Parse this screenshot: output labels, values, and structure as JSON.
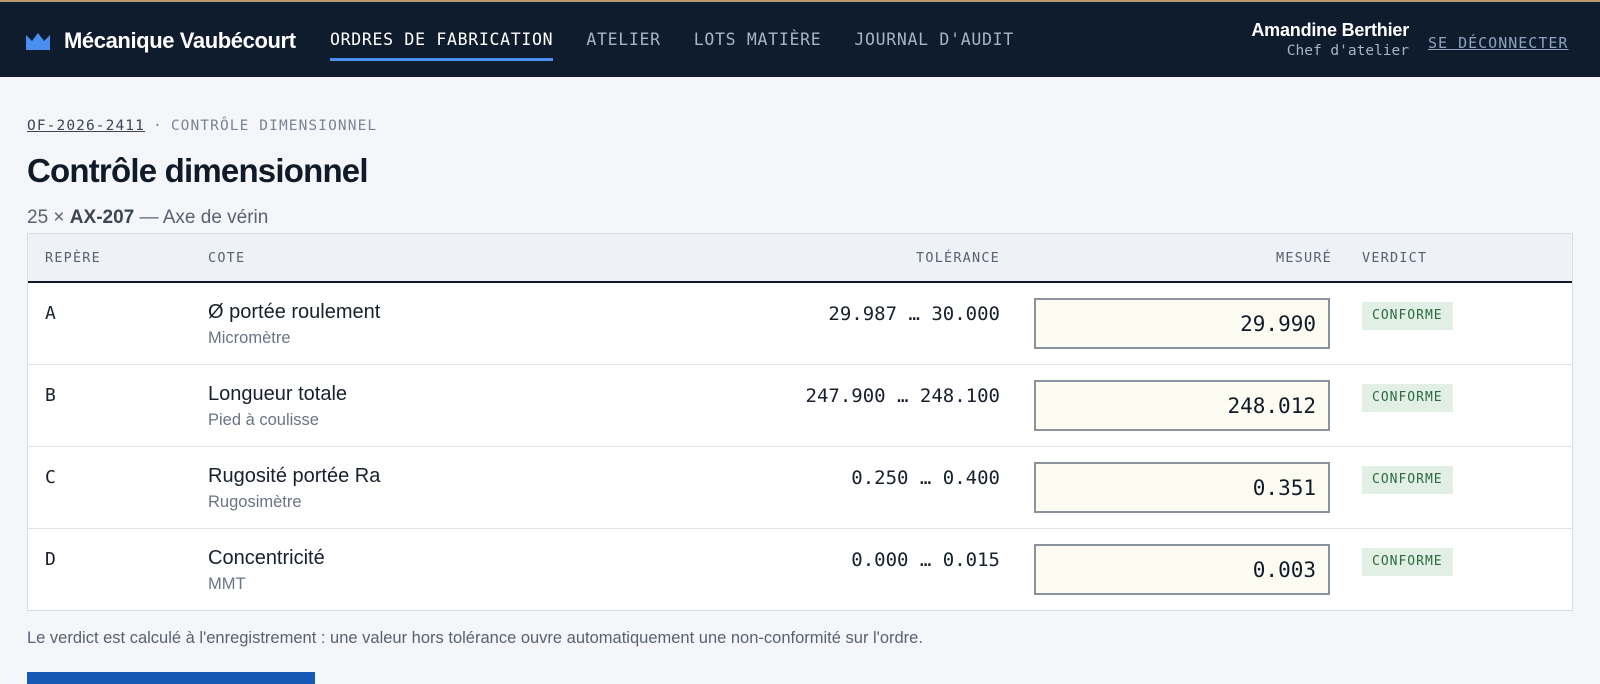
{
  "header": {
    "brand": "Mécanique Vaubécourt",
    "nav": [
      {
        "label": "ORDRES DE FABRICATION",
        "active": true
      },
      {
        "label": "ATELIER",
        "active": false
      },
      {
        "label": "LOTS MATIÈRE",
        "active": false
      },
      {
        "label": "JOURNAL D'AUDIT",
        "active": false
      }
    ],
    "user_name": "Amandine Berthier",
    "user_role": "Chef d'atelier",
    "logout": "SE DÉCONNECTER"
  },
  "breadcrumb": {
    "order_ref": "OF-2026-2411",
    "separator": "·",
    "current": "CONTRÔLE DIMENSIONNEL"
  },
  "page": {
    "title": "Contrôle dimensionnel",
    "qty": "25 ×",
    "part_no": "AX-207",
    "part_desc": "— Axe de vérin"
  },
  "table": {
    "headers": {
      "ref": "REPÈRE",
      "cote": "COTE",
      "tolerance": "TOLÉRANCE",
      "measured": "MESURÉ",
      "verdict": "VERDICT"
    },
    "rows": [
      {
        "ref": "A",
        "name": "Ø portée roulement",
        "instrument": "Micromètre",
        "tolerance": "29.987 … 30.000",
        "measured": "29.990",
        "verdict": "CONFORME"
      },
      {
        "ref": "B",
        "name": "Longueur totale",
        "instrument": "Pied à coulisse",
        "tolerance": "247.900 … 248.100",
        "measured": "248.012",
        "verdict": "CONFORME"
      },
      {
        "ref": "C",
        "name": "Rugosité portée Ra",
        "instrument": "Rugosimètre",
        "tolerance": "0.250 … 0.400",
        "measured": "0.351",
        "verdict": "CONFORME"
      },
      {
        "ref": "D",
        "name": "Concentricité",
        "instrument": "MMT",
        "tolerance": "0.000 … 0.015",
        "measured": "0.003",
        "verdict": "CONFORME"
      }
    ]
  },
  "note": "Le verdict est calculé à l'enregistrement : une valeur hors tolérance ouvre automatiquement une non-conformité sur l'ordre.",
  "colors": {
    "header_bg": "#0f1c2e",
    "accent": "#4a8ef0",
    "primary_button": "#1659b5",
    "badge_ok_bg": "#e1efe5",
    "badge_ok_text": "#2d6a42"
  }
}
